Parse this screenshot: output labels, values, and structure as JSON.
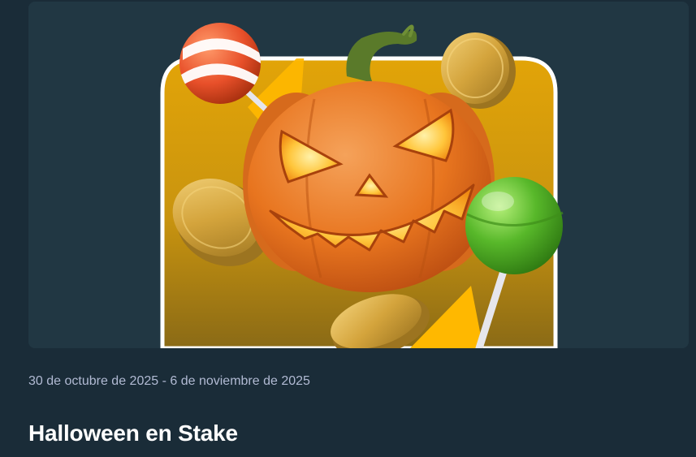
{
  "promotion": {
    "date_range": "30 de octubre de 2025 - 6 de noviembre de 2025",
    "title": "Halloween en Stake",
    "image_icon": "halloween-pumpkin-candy-illustration"
  },
  "colors": {
    "page_background": "#1a2c38",
    "card_background": "#213743",
    "tile_yellow": "#ffb800",
    "pumpkin_orange": "#e8751f",
    "coin_gold": "#d4a43c",
    "lollipop_green": "#58b82a",
    "lollipop_orange": "#e8502a",
    "date_text": "#b1bad3",
    "title_text": "#ffffff"
  }
}
